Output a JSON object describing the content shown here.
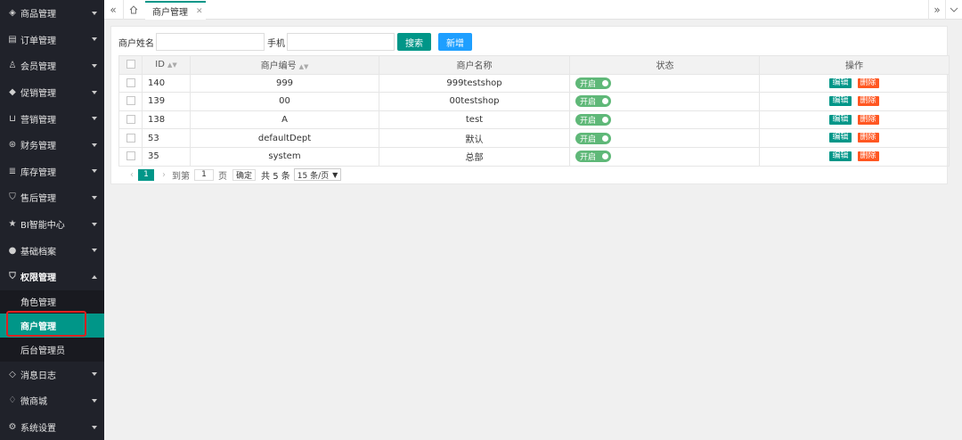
{
  "sidebar": {
    "items": [
      {
        "label": "商品管理",
        "icon": "box-icon"
      },
      {
        "label": "订单管理",
        "icon": "order-icon"
      },
      {
        "label": "会员管理",
        "icon": "user-icon"
      },
      {
        "label": "促销管理",
        "icon": "promo-icon"
      },
      {
        "label": "营销管理",
        "icon": "cart-icon"
      },
      {
        "label": "财务管理",
        "icon": "finance-icon"
      },
      {
        "label": "库存管理",
        "icon": "stock-icon"
      },
      {
        "label": "售后管理",
        "icon": "shield-icon"
      },
      {
        "label": "BI智能中心",
        "icon": "star-icon"
      },
      {
        "label": "基础档案",
        "icon": "circle-icon"
      },
      {
        "label": "权限管理",
        "icon": "shield-check-icon"
      }
    ],
    "sub_items": [
      {
        "label": "角色管理"
      },
      {
        "label": "商户管理"
      },
      {
        "label": "后台管理员"
      }
    ],
    "bottom_items": [
      {
        "label": "消息日志",
        "icon": "message-icon"
      },
      {
        "label": "微商城",
        "icon": "diamond-icon"
      },
      {
        "label": "系统设置",
        "icon": "gear-icon"
      }
    ]
  },
  "topbar": {
    "tab_label": "商户管理"
  },
  "search": {
    "name_label": "商户姓名",
    "phone_label": "手机",
    "search_button": "搜索",
    "add_button": "新增"
  },
  "table": {
    "headers": {
      "id": "ID",
      "code": "商户编号",
      "name": "商户名称",
      "status": "状态",
      "actions": "操作"
    },
    "rows": [
      {
        "id": "140",
        "code": "999",
        "name": "999testshop",
        "status": "开启"
      },
      {
        "id": "139",
        "code": "00",
        "name": "00testshop",
        "status": "开启"
      },
      {
        "id": "138",
        "code": "A",
        "name": "test",
        "status": "开启"
      },
      {
        "id": "53",
        "code": "defaultDept",
        "name": "默认",
        "status": "开启"
      },
      {
        "id": "35",
        "code": "system",
        "name": "总部",
        "status": "开启"
      }
    ],
    "edit_label": "编辑",
    "delete_label": "删除"
  },
  "pager": {
    "current_page": "1",
    "goto_label": "到第",
    "page_input": "1",
    "page_unit": "页",
    "confirm_button": "确定",
    "total_text": "共 5 条",
    "page_size": "15 条/页"
  },
  "colors": {
    "sidebar_bg": "#20222a",
    "accent": "#009688",
    "add_button": "#1e9fff",
    "switch_on": "#5fb878",
    "delete": "#ff5722",
    "highlight": "#e02020"
  }
}
